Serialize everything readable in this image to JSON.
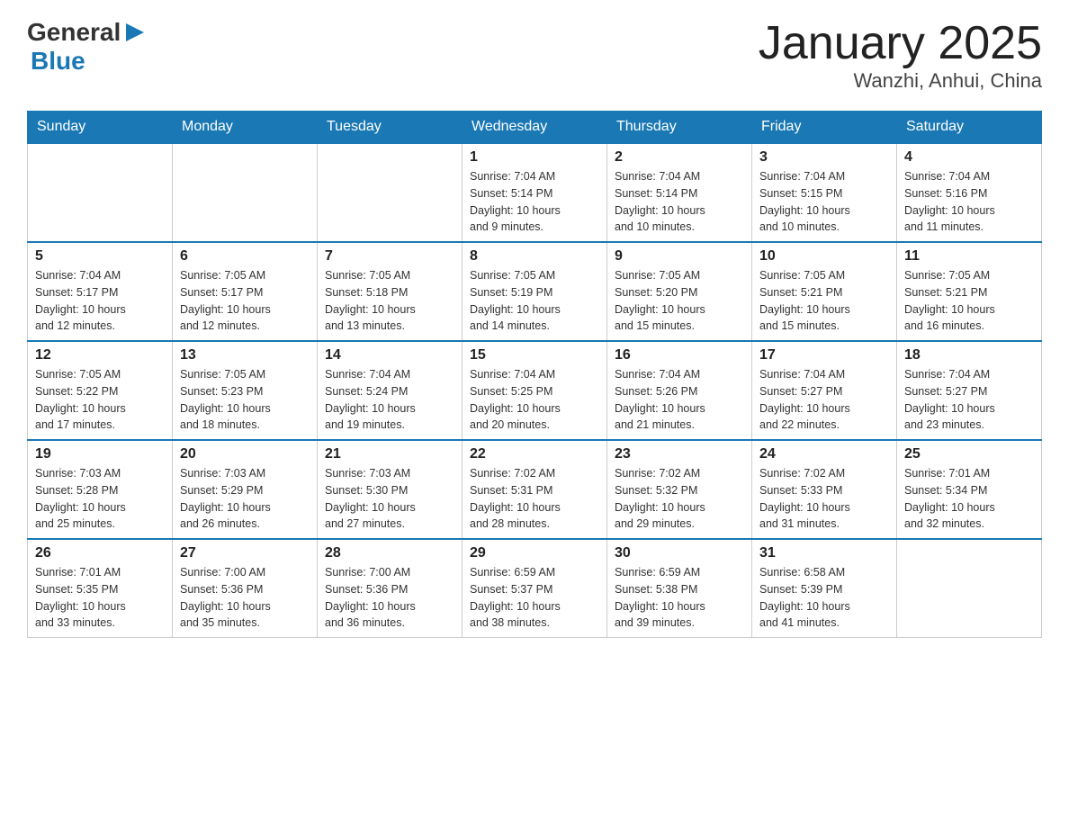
{
  "header": {
    "logo_general": "General",
    "logo_blue": "Blue",
    "title": "January 2025",
    "subtitle": "Wanzhi, Anhui, China"
  },
  "weekdays": [
    "Sunday",
    "Monday",
    "Tuesday",
    "Wednesday",
    "Thursday",
    "Friday",
    "Saturday"
  ],
  "weeks": [
    [
      {
        "day": "",
        "info": ""
      },
      {
        "day": "",
        "info": ""
      },
      {
        "day": "",
        "info": ""
      },
      {
        "day": "1",
        "info": "Sunrise: 7:04 AM\nSunset: 5:14 PM\nDaylight: 10 hours\nand 9 minutes."
      },
      {
        "day": "2",
        "info": "Sunrise: 7:04 AM\nSunset: 5:14 PM\nDaylight: 10 hours\nand 10 minutes."
      },
      {
        "day": "3",
        "info": "Sunrise: 7:04 AM\nSunset: 5:15 PM\nDaylight: 10 hours\nand 10 minutes."
      },
      {
        "day": "4",
        "info": "Sunrise: 7:04 AM\nSunset: 5:16 PM\nDaylight: 10 hours\nand 11 minutes."
      }
    ],
    [
      {
        "day": "5",
        "info": "Sunrise: 7:04 AM\nSunset: 5:17 PM\nDaylight: 10 hours\nand 12 minutes."
      },
      {
        "day": "6",
        "info": "Sunrise: 7:05 AM\nSunset: 5:17 PM\nDaylight: 10 hours\nand 12 minutes."
      },
      {
        "day": "7",
        "info": "Sunrise: 7:05 AM\nSunset: 5:18 PM\nDaylight: 10 hours\nand 13 minutes."
      },
      {
        "day": "8",
        "info": "Sunrise: 7:05 AM\nSunset: 5:19 PM\nDaylight: 10 hours\nand 14 minutes."
      },
      {
        "day": "9",
        "info": "Sunrise: 7:05 AM\nSunset: 5:20 PM\nDaylight: 10 hours\nand 15 minutes."
      },
      {
        "day": "10",
        "info": "Sunrise: 7:05 AM\nSunset: 5:21 PM\nDaylight: 10 hours\nand 15 minutes."
      },
      {
        "day": "11",
        "info": "Sunrise: 7:05 AM\nSunset: 5:21 PM\nDaylight: 10 hours\nand 16 minutes."
      }
    ],
    [
      {
        "day": "12",
        "info": "Sunrise: 7:05 AM\nSunset: 5:22 PM\nDaylight: 10 hours\nand 17 minutes."
      },
      {
        "day": "13",
        "info": "Sunrise: 7:05 AM\nSunset: 5:23 PM\nDaylight: 10 hours\nand 18 minutes."
      },
      {
        "day": "14",
        "info": "Sunrise: 7:04 AM\nSunset: 5:24 PM\nDaylight: 10 hours\nand 19 minutes."
      },
      {
        "day": "15",
        "info": "Sunrise: 7:04 AM\nSunset: 5:25 PM\nDaylight: 10 hours\nand 20 minutes."
      },
      {
        "day": "16",
        "info": "Sunrise: 7:04 AM\nSunset: 5:26 PM\nDaylight: 10 hours\nand 21 minutes."
      },
      {
        "day": "17",
        "info": "Sunrise: 7:04 AM\nSunset: 5:27 PM\nDaylight: 10 hours\nand 22 minutes."
      },
      {
        "day": "18",
        "info": "Sunrise: 7:04 AM\nSunset: 5:27 PM\nDaylight: 10 hours\nand 23 minutes."
      }
    ],
    [
      {
        "day": "19",
        "info": "Sunrise: 7:03 AM\nSunset: 5:28 PM\nDaylight: 10 hours\nand 25 minutes."
      },
      {
        "day": "20",
        "info": "Sunrise: 7:03 AM\nSunset: 5:29 PM\nDaylight: 10 hours\nand 26 minutes."
      },
      {
        "day": "21",
        "info": "Sunrise: 7:03 AM\nSunset: 5:30 PM\nDaylight: 10 hours\nand 27 minutes."
      },
      {
        "day": "22",
        "info": "Sunrise: 7:02 AM\nSunset: 5:31 PM\nDaylight: 10 hours\nand 28 minutes."
      },
      {
        "day": "23",
        "info": "Sunrise: 7:02 AM\nSunset: 5:32 PM\nDaylight: 10 hours\nand 29 minutes."
      },
      {
        "day": "24",
        "info": "Sunrise: 7:02 AM\nSunset: 5:33 PM\nDaylight: 10 hours\nand 31 minutes."
      },
      {
        "day": "25",
        "info": "Sunrise: 7:01 AM\nSunset: 5:34 PM\nDaylight: 10 hours\nand 32 minutes."
      }
    ],
    [
      {
        "day": "26",
        "info": "Sunrise: 7:01 AM\nSunset: 5:35 PM\nDaylight: 10 hours\nand 33 minutes."
      },
      {
        "day": "27",
        "info": "Sunrise: 7:00 AM\nSunset: 5:36 PM\nDaylight: 10 hours\nand 35 minutes."
      },
      {
        "day": "28",
        "info": "Sunrise: 7:00 AM\nSunset: 5:36 PM\nDaylight: 10 hours\nand 36 minutes."
      },
      {
        "day": "29",
        "info": "Sunrise: 6:59 AM\nSunset: 5:37 PM\nDaylight: 10 hours\nand 38 minutes."
      },
      {
        "day": "30",
        "info": "Sunrise: 6:59 AM\nSunset: 5:38 PM\nDaylight: 10 hours\nand 39 minutes."
      },
      {
        "day": "31",
        "info": "Sunrise: 6:58 AM\nSunset: 5:39 PM\nDaylight: 10 hours\nand 41 minutes."
      },
      {
        "day": "",
        "info": ""
      }
    ]
  ]
}
